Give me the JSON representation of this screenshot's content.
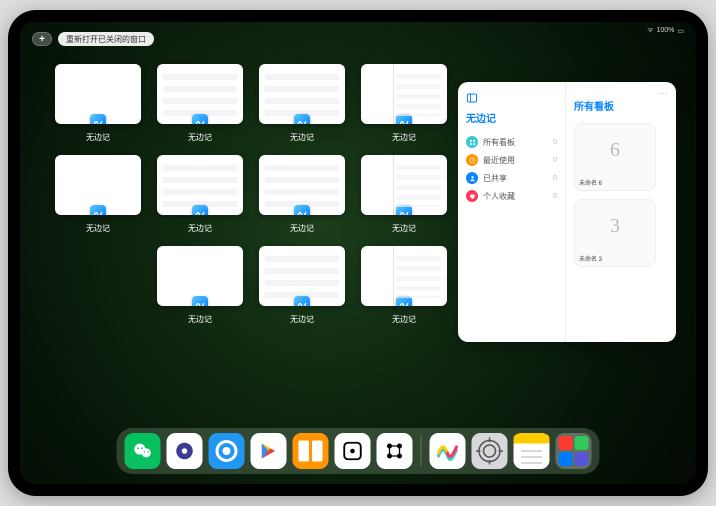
{
  "status": {
    "time": "",
    "battery": "100%"
  },
  "top": {
    "plus": "+",
    "reopen_label": "重新打开已关闭的窗口"
  },
  "app_name": "无边记",
  "windows": [
    {
      "label": "无边记",
      "variant": "blank"
    },
    {
      "label": "无边记",
      "variant": "list"
    },
    {
      "label": "无边记",
      "variant": "list"
    },
    {
      "label": "无边记",
      "variant": "split"
    },
    {
      "label": "无边记",
      "variant": "blank"
    },
    {
      "label": "无边记",
      "variant": "list"
    },
    {
      "label": "无边记",
      "variant": "list"
    },
    {
      "label": "无边记",
      "variant": "split"
    },
    {
      "label": "无边记",
      "variant": "blank"
    },
    {
      "label": "无边记",
      "variant": "list"
    },
    {
      "label": "无边记",
      "variant": "split"
    }
  ],
  "panel": {
    "left_title": "无边记",
    "right_title": "所有看板",
    "more": "···",
    "categories": [
      {
        "icon": "grid",
        "color": "#32c9d6",
        "label": "所有看板",
        "count": 0
      },
      {
        "icon": "clock",
        "color": "#ff9500",
        "label": "最近使用",
        "count": 0
      },
      {
        "icon": "person",
        "color": "#0a84ff",
        "label": "已共享",
        "count": 0
      },
      {
        "icon": "heart",
        "color": "#ff375f",
        "label": "个人收藏",
        "count": 0
      }
    ],
    "boards": [
      {
        "drawing": "6",
        "name": "未命名 6",
        "date": ""
      },
      {
        "drawing": "3",
        "name": "未命名 3",
        "date": ""
      }
    ]
  },
  "dock": {
    "apps": [
      {
        "name": "wechat",
        "bg": "#07c160"
      },
      {
        "name": "quark",
        "bg": "#ffffff"
      },
      {
        "name": "qqbrowser",
        "bg": "#2196f3"
      },
      {
        "name": "play",
        "bg": "#ffffff"
      },
      {
        "name": "books",
        "bg": "#ff9500"
      },
      {
        "name": "dice",
        "bg": "#ffffff"
      },
      {
        "name": "connect",
        "bg": "#ffffff"
      }
    ],
    "recent": [
      {
        "name": "freeform",
        "bg": "#ffffff"
      },
      {
        "name": "settings",
        "bg": "#8e8e93"
      },
      {
        "name": "notes",
        "bg": "#ffffff"
      }
    ],
    "folder": [
      {
        "bg": "#ff3b30"
      },
      {
        "bg": "#34c759"
      },
      {
        "bg": "#007aff"
      },
      {
        "bg": "#5856d6"
      }
    ]
  }
}
